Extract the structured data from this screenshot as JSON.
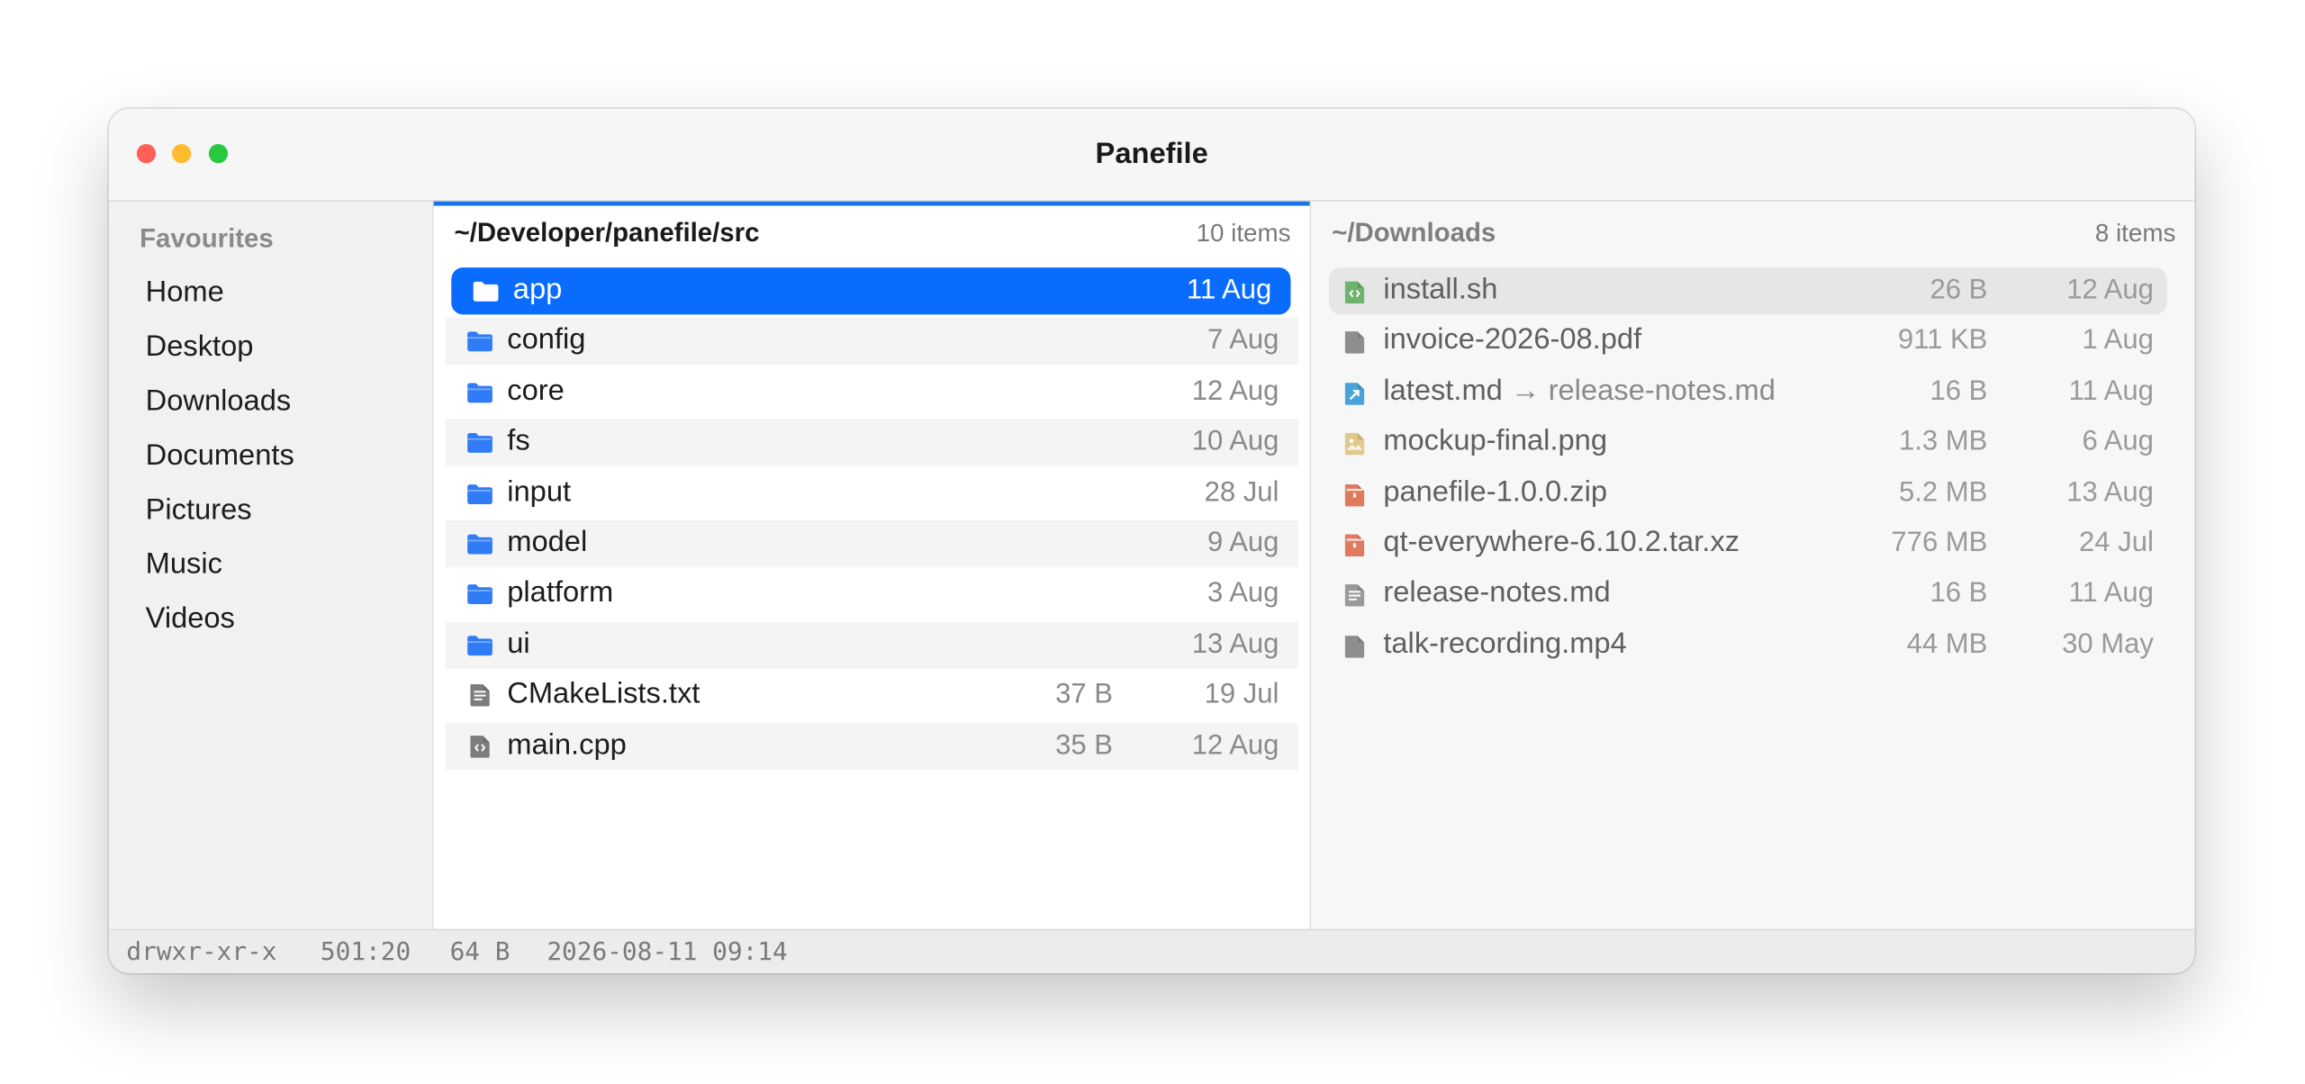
{
  "window": {
    "title": "Panefile"
  },
  "sidebar": {
    "heading": "Favourites",
    "items": [
      {
        "label": "Home"
      },
      {
        "label": "Desktop"
      },
      {
        "label": "Downloads"
      },
      {
        "label": "Documents"
      },
      {
        "label": "Pictures"
      },
      {
        "label": "Music"
      },
      {
        "label": "Videos"
      }
    ]
  },
  "left_pane": {
    "path": "~/Developer/panefile/src",
    "count": "10 items",
    "rows": [
      {
        "name": "app",
        "size": "",
        "date": "11 Aug",
        "icon": "folder-icon"
      },
      {
        "name": "config",
        "size": "",
        "date": "7 Aug",
        "icon": "folder-icon"
      },
      {
        "name": "core",
        "size": "",
        "date": "12 Aug",
        "icon": "folder-icon"
      },
      {
        "name": "fs",
        "size": "",
        "date": "10 Aug",
        "icon": "folder-icon"
      },
      {
        "name": "input",
        "size": "",
        "date": "28 Jul",
        "icon": "folder-icon"
      },
      {
        "name": "model",
        "size": "",
        "date": "9 Aug",
        "icon": "folder-icon"
      },
      {
        "name": "platform",
        "size": "",
        "date": "3 Aug",
        "icon": "folder-icon"
      },
      {
        "name": "ui",
        "size": "",
        "date": "13 Aug",
        "icon": "folder-icon"
      },
      {
        "name": "CMakeLists.txt",
        "size": "37 B",
        "date": "19 Jul",
        "icon": "text-file-icon"
      },
      {
        "name": "main.cpp",
        "size": "35 B",
        "date": "12 Aug",
        "icon": "code-file-icon"
      }
    ]
  },
  "right_pane": {
    "path": "~/Downloads",
    "count": "8 items",
    "rows": [
      {
        "name": "install.sh",
        "link": "",
        "size": "26 B",
        "date": "12 Aug",
        "icon": "script-file-icon",
        "color": "#6db36d"
      },
      {
        "name": "invoice-2026-08.pdf",
        "link": "",
        "size": "911 KB",
        "date": "1 Aug",
        "icon": "document-file-icon",
        "color": "#8e8e8e"
      },
      {
        "name": "latest.md",
        "link": "→ release-notes.md",
        "size": "16 B",
        "date": "11 Aug",
        "icon": "symlink-file-icon",
        "color": "#4aa3d8"
      },
      {
        "name": "mockup-final.png",
        "link": "",
        "size": "1.3 MB",
        "date": "6 Aug",
        "icon": "image-file-icon",
        "color": "#e0c98a"
      },
      {
        "name": "panefile-1.0.0.zip",
        "link": "",
        "size": "5.2 MB",
        "date": "13 Aug",
        "icon": "archive-file-icon",
        "color": "#e07a5f"
      },
      {
        "name": "qt-everywhere-6.10.2.tar.xz",
        "link": "",
        "size": "776 MB",
        "date": "24 Jul",
        "icon": "archive-file-icon",
        "color": "#e07a5f"
      },
      {
        "name": "release-notes.md",
        "link": "",
        "size": "16 B",
        "date": "11 Aug",
        "icon": "text-file-icon",
        "color": "#9a9a9a"
      },
      {
        "name": "talk-recording.mp4",
        "link": "",
        "size": "44 MB",
        "date": "30 May",
        "icon": "video-file-icon",
        "color": "#8e8e8e"
      }
    ]
  },
  "status": {
    "permissions": "drwxr-xr-x",
    "owner": "501:20",
    "size": "64 B",
    "modified": "2026-08-11 09:14"
  },
  "colors": {
    "accent": "#0a6cff",
    "folder": "#2f7cf6"
  }
}
